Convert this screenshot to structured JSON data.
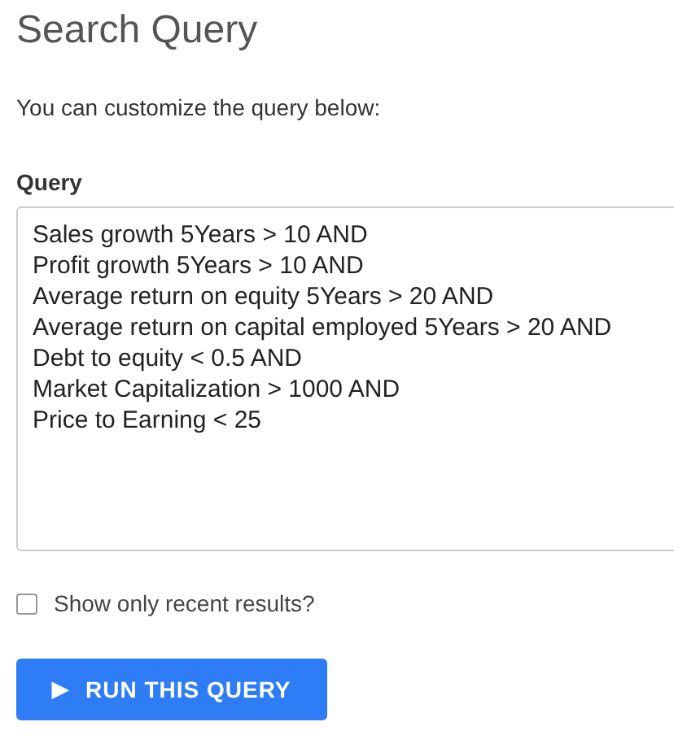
{
  "title": "Search Query",
  "intro": "You can customize the query below:",
  "query": {
    "label": "Query",
    "value": "Sales growth 5Years > 10 AND\nProfit growth 5Years > 10 AND\nAverage return on equity 5Years > 20 AND\nAverage return on capital employed 5Years > 20 AND\nDebt to equity < 0.5 AND\nMarket Capitalization > 1000 AND\nPrice to Earning < 25"
  },
  "recent": {
    "label": "Show only recent results?",
    "checked": false
  },
  "button": {
    "icon": "▶",
    "label": "RUN THIS QUERY"
  }
}
